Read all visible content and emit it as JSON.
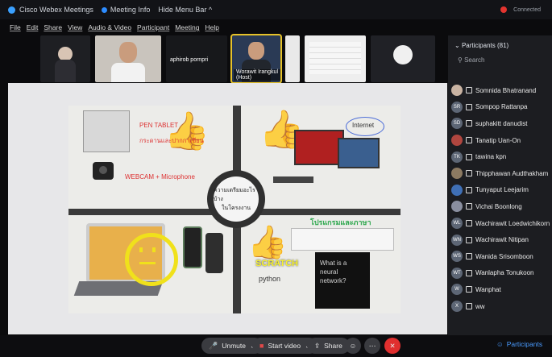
{
  "titlebar": {
    "app": "Cisco Webex Meetings",
    "meeting_info": "Meeting Info",
    "hide_menu": "Hide Menu Bar ^",
    "status": "Connected"
  },
  "menu": [
    "File",
    "Edit",
    "Share",
    "View",
    "Audio & Video",
    "Participant",
    "Meeting",
    "Help"
  ],
  "video_strip": {
    "tiles": [
      {
        "name": ""
      },
      {
        "name": ""
      },
      {
        "name": "aphirob pornpri"
      },
      {
        "name": "Worawit Irangkul (Host)"
      },
      {
        "name": ""
      },
      {
        "name": ""
      },
      {
        "name": ""
      }
    ]
  },
  "participants": {
    "title": "Participants (81)",
    "search_placeholder": "Search",
    "list": [
      {
        "initials": "",
        "name": "Somnida Bhatranand"
      },
      {
        "initials": "SR",
        "name": "Sompop Rattanpa"
      },
      {
        "initials": "SD",
        "name": "suphakitt danudist"
      },
      {
        "initials": "",
        "name": "Tanatip Uan-On"
      },
      {
        "initials": "TK",
        "name": "tawina kpn"
      },
      {
        "initials": "",
        "name": "Thipphawan Audthakham"
      },
      {
        "initials": "",
        "name": "Tunyaput Leejarim"
      },
      {
        "initials": "",
        "name": "Vichai Boonlong"
      },
      {
        "initials": "WL",
        "name": "Wachirawit Loedwichikorn"
      },
      {
        "initials": "WN",
        "name": "Wachirawit Nitipan"
      },
      {
        "initials": "WS",
        "name": "Wanida Srisomboon"
      },
      {
        "initials": "WT",
        "name": "Wanlapha Tonukoon"
      },
      {
        "initials": "W",
        "name": "Wanphat"
      },
      {
        "initials": "X",
        "name": "ww"
      }
    ]
  },
  "slide": {
    "pen_tablet": "PEN TABLET",
    "pen_tablet_th": "กระดานและปากกาเขียน",
    "webcam": "WEBCAM + Microphone",
    "internet": "Internet",
    "center_line1": "ความเตรียมอะไรบ้าง",
    "center_line2": "ในโครงงาน",
    "q4_title": "โปรแกรมและภาษา",
    "scratch": "SCRATCH",
    "python": "python",
    "neural": "What is a neural network?"
  },
  "controls": {
    "unmute": "Unmute",
    "start_video": "Start video",
    "share": "Share",
    "participants_tab": "Participants"
  },
  "colors": {
    "accent_blue": "#2d8cff",
    "end_red": "#e02f2f",
    "host_outline": "#e6c229"
  }
}
